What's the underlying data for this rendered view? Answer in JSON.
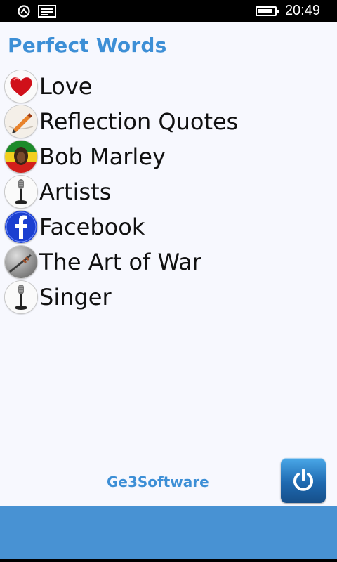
{
  "status_bar": {
    "time": "20:49",
    "icons": [
      "sync-icon",
      "message-icon",
      "battery-icon"
    ],
    "battery_level_percent": 85
  },
  "app": {
    "title": "Perfect Words",
    "accent_color": "#3d8fd6",
    "appbar_color": "#4892d3"
  },
  "menu": {
    "items": [
      {
        "label": "Love",
        "icon": "heart-icon"
      },
      {
        "label": "Reflection Quotes",
        "icon": "pen-writing-icon"
      },
      {
        "label": "Bob Marley",
        "icon": "bob-marley-icon"
      },
      {
        "label": "Artists",
        "icon": "microphone-icon"
      },
      {
        "label": "Facebook",
        "icon": "facebook-icon"
      },
      {
        "label": "The Art of War",
        "icon": "sword-icon"
      },
      {
        "label": "Singer",
        "icon": "microphone-icon"
      }
    ]
  },
  "footer": {
    "brand": "Ge3Software",
    "power_icon": "power-icon"
  }
}
